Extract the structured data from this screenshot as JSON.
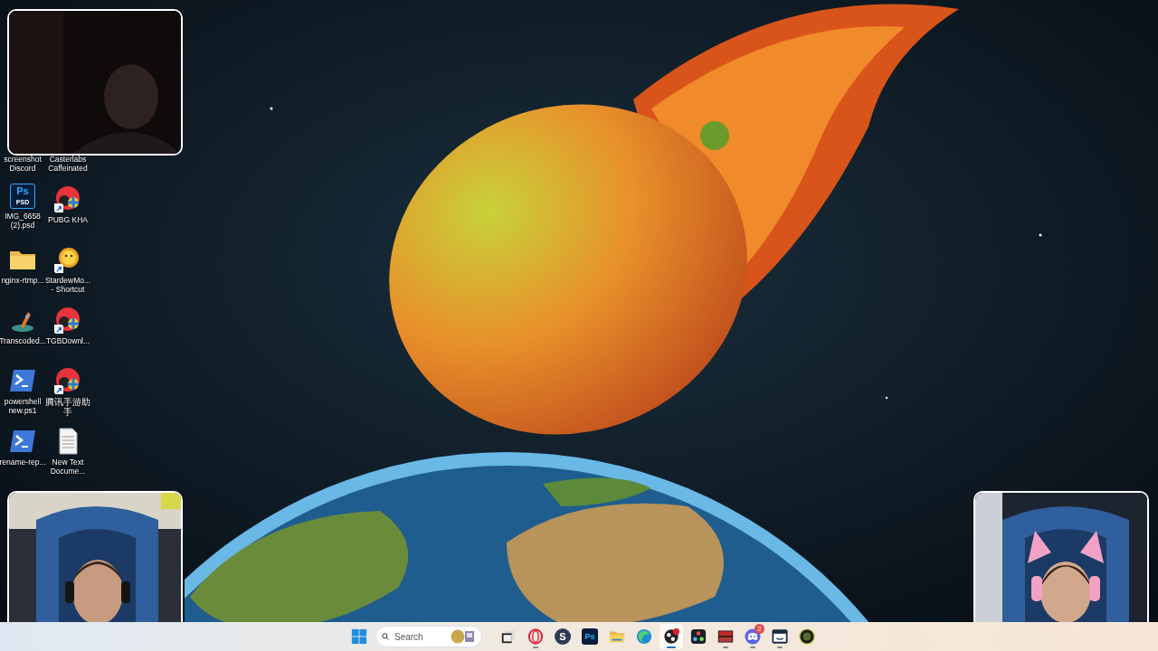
{
  "desktop_icons": [
    {
      "label": "screenshot Discord",
      "kind": "none",
      "shortcut": false
    },
    {
      "label": "Casterlabs Caffeinated",
      "kind": "none",
      "shortcut": false
    },
    {
      "label": "IMG_6658 (2).psd",
      "kind": "psd",
      "shortcut": false,
      "glyph": "Ps",
      "sub_glyph": "PSD"
    },
    {
      "label": "PUBG KHA",
      "kind": "swirl",
      "shortcut": true
    },
    {
      "label": "nginx-rtmp...",
      "kind": "folder",
      "shortcut": false
    },
    {
      "label": "StardewMo... - Shortcut",
      "kind": "sun",
      "shortcut": true
    },
    {
      "label": "Transcoded...",
      "kind": "rocket",
      "shortcut": false
    },
    {
      "label": "TGBDownl...",
      "kind": "swirl",
      "shortcut": true
    },
    {
      "label": "powershell new.ps1",
      "kind": "terminal",
      "shortcut": false
    },
    {
      "label": "腾讯手游助手",
      "kind": "swirl",
      "shortcut": true
    },
    {
      "label": "rename-rep...",
      "kind": "terminal",
      "shortcut": false
    },
    {
      "label": "New Text Docume...",
      "kind": "document",
      "shortcut": false
    }
  ],
  "taskbar": {
    "search": {
      "placeholder": "Search"
    },
    "apps": [
      {
        "kind": "files",
        "running": false,
        "selected": false
      },
      {
        "kind": "ring",
        "running": true,
        "selected": false
      },
      {
        "kind": "letter",
        "glyph": "S",
        "running": false,
        "selected": false
      },
      {
        "kind": "photoshop",
        "glyph": "Ps",
        "running": false,
        "selected": false
      },
      {
        "kind": "folder",
        "running": false,
        "selected": false
      },
      {
        "kind": "edge",
        "running": false,
        "selected": false
      },
      {
        "kind": "recorder",
        "running": true,
        "selected": true
      },
      {
        "kind": "editor",
        "running": false,
        "selected": false
      },
      {
        "kind": "mixer",
        "running": true,
        "selected": false
      },
      {
        "kind": "chat",
        "badge": "2",
        "running": true,
        "selected": false
      },
      {
        "kind": "window",
        "running": true,
        "selected": false
      },
      {
        "kind": "gauge",
        "running": false,
        "selected": false
      }
    ]
  }
}
